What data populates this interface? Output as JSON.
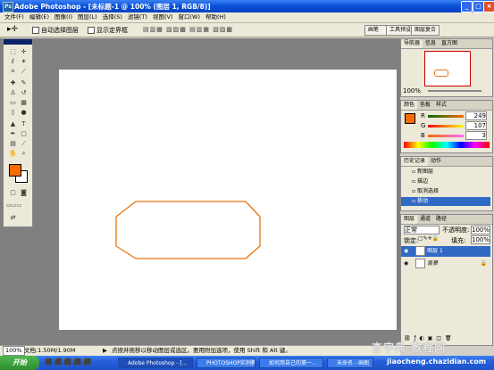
{
  "window": {
    "app_title": "Adobe Photoshop - [未标题-1 @ 100% (图层 1, RGB/8)]"
  },
  "menubar": {
    "items": [
      "文件(F)",
      "编辑(E)",
      "图像(I)",
      "图层(L)",
      "选择(S)",
      "滤镜(T)",
      "视图(V)",
      "窗口(W)",
      "帮助(H)"
    ]
  },
  "options": {
    "auto_select_label": "自动选择图层",
    "show_bounds_label": "显示定界框",
    "well_tabs": [
      "画笔",
      "工具预设",
      "图层复合"
    ]
  },
  "navigator": {
    "tabs": [
      "导航器",
      "信息",
      "直方图"
    ],
    "zoom": "100%"
  },
  "color": {
    "tabs": [
      "颜色",
      "色板",
      "样式"
    ],
    "r_label": "R",
    "g_label": "G",
    "b_label": "B",
    "r_value": "249",
    "g_value": "107",
    "b_value": "3",
    "foreground_hex": "#f96b03"
  },
  "history": {
    "tabs": [
      "历史记录",
      "动作"
    ],
    "items": [
      "新图层",
      "描边",
      "取消选择",
      "移动"
    ]
  },
  "layers": {
    "tabs": [
      "图层",
      "通道",
      "路径"
    ],
    "blend_mode": "正常",
    "opacity_label": "不透明度:",
    "opacity_value": "100%",
    "lock_label": "锁定:",
    "fill_label": "填充:",
    "fill_value": "100%",
    "rows": [
      "图层 1",
      "背景"
    ]
  },
  "status": {
    "zoom": "100%",
    "doc_info": "文档:1.50M/1.90M",
    "hint": "点按并拖移以移动图层或选区。要用附加选项，使用 Shift 和 Alt 键。"
  },
  "taskbar": {
    "start_label": "开始",
    "tasks": [
      "Adobe Photoshop - [...",
      "PHOTOSHOP实例教学",
      "如何用自己的第一...",
      "未命名 - 画图"
    ]
  },
  "watermark": {
    "line1": "查字典",
    "line2": "教程网",
    "url": "jiaocheng.chazidian.com"
  },
  "colors": {
    "shape_stroke": "#e87511"
  }
}
